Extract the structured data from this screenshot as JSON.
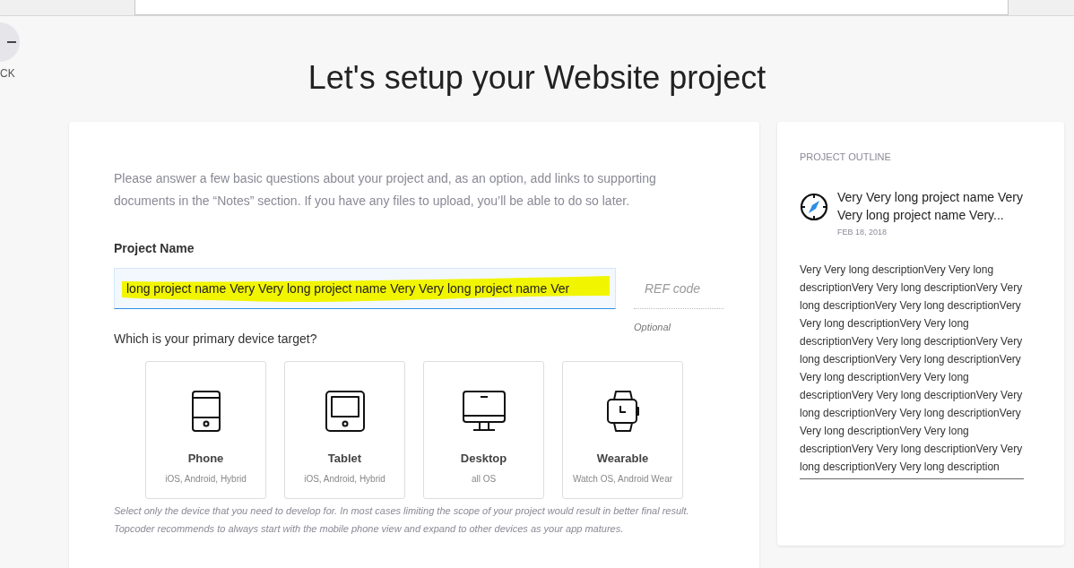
{
  "back": {
    "label": "CK"
  },
  "title": "Let's setup your Website project",
  "form": {
    "intro": "Please answer a few basic questions about your project and, as an option, add links to supporting documents in the “Notes” section. If you have any files to upload, you’ll be able to do so later.",
    "project_name": {
      "label": "Project Name",
      "value": "long project name Very Very long project name Very Very long project name Ver",
      "highlighted": true
    },
    "ref_code": {
      "placeholder": "REF code",
      "hint": "Optional"
    },
    "device_question": "Which is your primary device target?",
    "devices": [
      {
        "kind": "phone",
        "name": "Phone",
        "platforms": "iOS, Android, Hybrid",
        "selected": false
      },
      {
        "kind": "tablet",
        "name": "Tablet",
        "platforms": "iOS, Android, Hybrid",
        "selected": false
      },
      {
        "kind": "desktop",
        "name": "Desktop",
        "platforms": "all OS",
        "selected": false
      },
      {
        "kind": "wearable",
        "name": "Wearable",
        "platforms": "Watch OS, Android Wear",
        "selected": false
      }
    ],
    "device_note": "Select only the device that you need to develop for. In most cases limiting the scope of your project would result in better final result. Topcoder recommends to always start with the mobile phone view and expand to other devices as your app matures."
  },
  "outline": {
    "heading": "PROJECT OUTLINE",
    "project_title": "Very Very long project name Very Very long project name Very...",
    "date": "FEB 18, 2018",
    "description": "Very Very long descriptionVery Very long descriptionVery Very long descriptionVery Very long descriptionVery Very long descriptionVery Very long descriptionVery Very long descriptionVery Very long descriptionVery Very long descriptionVery Very long descriptionVery Very long descriptionVery Very long descriptionVery Very long descriptionVery Very long descriptionVery Very long descriptionVery Very long descriptionVery Very long descriptionVery Very long descriptionVery Very long descriptionVery Very long description"
  }
}
